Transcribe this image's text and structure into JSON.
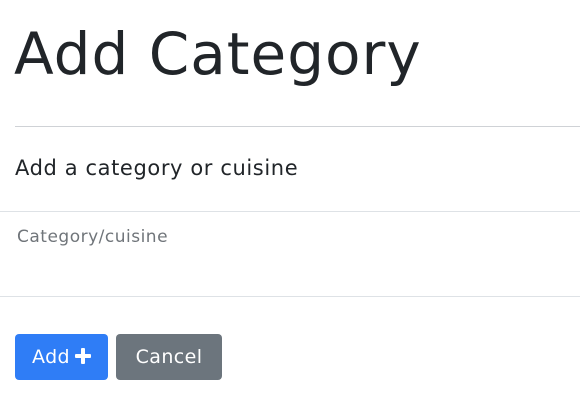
{
  "page": {
    "title": "Add Category"
  },
  "form": {
    "label": "Add a category or cuisine",
    "input": {
      "placeholder": "Category/cuisine",
      "value": ""
    },
    "add_button": {
      "label": "Add",
      "icon": "plus-icon",
      "color": "#2f7df6"
    },
    "cancel_button": {
      "label": "Cancel",
      "color": "#6c757d"
    }
  }
}
